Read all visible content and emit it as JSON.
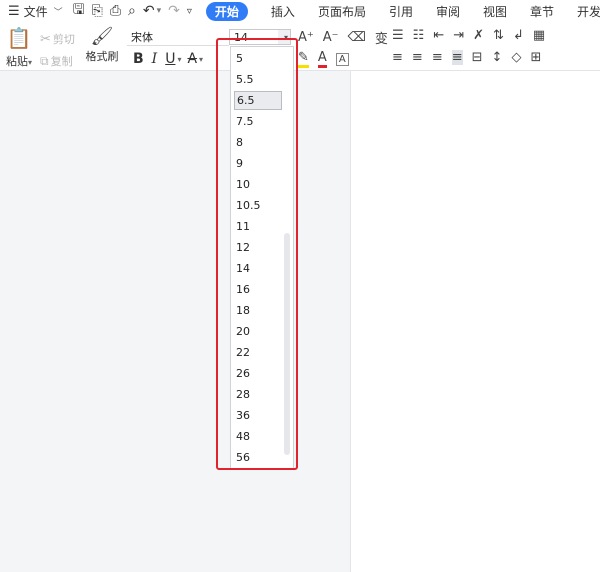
{
  "menu": {
    "file_label": "文件"
  },
  "tabs": [
    {
      "label": "开始"
    },
    {
      "label": "插入"
    },
    {
      "label": "页面布局"
    },
    {
      "label": "引用"
    },
    {
      "label": "审阅"
    },
    {
      "label": "视图"
    },
    {
      "label": "章节"
    },
    {
      "label": "开发工具"
    }
  ],
  "clipboard": {
    "paste_label": "粘贴",
    "cut_label": "剪切",
    "copy_label": "复制",
    "format_painter_label": "格式刷"
  },
  "font": {
    "name": "宋体",
    "size": "14"
  },
  "font_size_options": [
    "5",
    "5.5",
    "6.5",
    "7.5",
    "8",
    "9",
    "10",
    "10.5",
    "11",
    "12",
    "14",
    "16",
    "18",
    "20",
    "22",
    "26",
    "28",
    "36",
    "48",
    "56"
  ],
  "selected_option": "6.5",
  "colors": {
    "accent": "#2f7cf6",
    "highlight_frame": "#e0242f"
  }
}
